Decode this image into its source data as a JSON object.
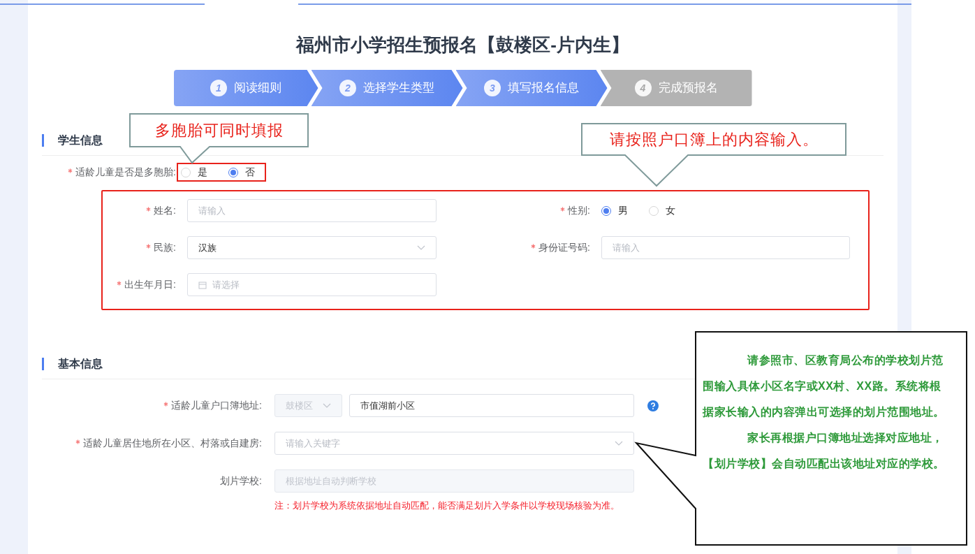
{
  "title": "福州市小学招生预报名【鼓楼区-片内生】",
  "steps": [
    {
      "number": "1",
      "label": "阅读细则",
      "reached": true
    },
    {
      "number": "2",
      "label": "选择学生类型",
      "reached": true
    },
    {
      "number": "3",
      "label": "填写报名信息",
      "reached": true
    },
    {
      "number": "4",
      "label": "完成预报名",
      "reached": false
    }
  ],
  "student_info": {
    "heading": "学生信息",
    "multiple_birth": {
      "label": "适龄儿童是否是多胞胎:",
      "required": true,
      "options": [
        {
          "label": "是",
          "selected": false
        },
        {
          "label": "否",
          "selected": true
        }
      ]
    },
    "fields": [
      {
        "kind": "text",
        "label": "姓名:",
        "required": true,
        "placeholder": "请输入"
      },
      {
        "kind": "radio",
        "label": "性别:",
        "required": true,
        "options": [
          {
            "label": "男",
            "selected": true
          },
          {
            "label": "女",
            "selected": false
          }
        ]
      },
      {
        "kind": "select",
        "label": "民族:",
        "required": true,
        "value": "汉族"
      },
      {
        "kind": "text",
        "label": "身份证号码:",
        "required": true,
        "placeholder": "请输入"
      },
      {
        "kind": "date",
        "label": "出生年月日:",
        "required": true,
        "placeholder": "请选择"
      }
    ]
  },
  "basic_info": {
    "heading": "基本信息",
    "fields": [
      {
        "kind": "district_address",
        "label": "适龄儿童户口簿地址:",
        "required": true,
        "district": "鼓楼区",
        "value": "市值湖前小区"
      },
      {
        "kind": "select",
        "label": "适龄儿童居住地所在小区、村落或自建房:",
        "required": true,
        "placeholder": "请输入关键字"
      },
      {
        "kind": "disabled_text",
        "label": "划片学校:",
        "required": false,
        "placeholder": "根据地址自动判断学校"
      }
    ],
    "note": "注：划片学校为系统依据地址自动匹配，能否满足划片入学条件以学校现场核验为准。"
  },
  "annotations": [
    {
      "kind": "red",
      "paragraphs": [
        "多胞胎可同时填报"
      ]
    },
    {
      "kind": "red",
      "paragraphs": [
        "请按照户口簿上的内容输入。"
      ]
    },
    {
      "kind": "green",
      "paragraphs": [
        "请参照市、区教育局公布的学校划片范围输入具体小区名字或XX村、XX路。系统将根据家长输入的内容弹出可选择的划片范围地址。",
        "家长再根据户口簿地址选择对应地址，【划片学校】会自动匹配出该地址对应的学校。"
      ]
    }
  ]
}
